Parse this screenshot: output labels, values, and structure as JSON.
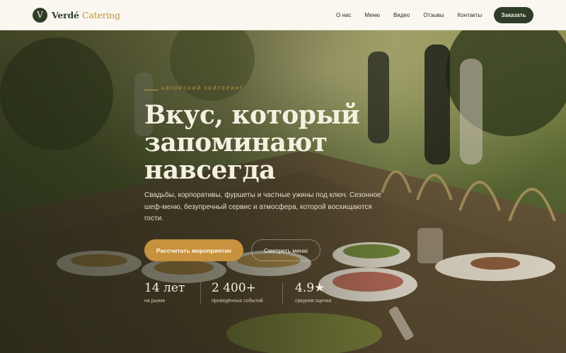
{
  "header": {
    "logo_letter": "V",
    "brand_main": "Verdé",
    "brand_accent": "Catering",
    "nav": [
      "О нас",
      "Меню",
      "Видео",
      "Отзывы",
      "Контакты"
    ],
    "order_label": "Заказать"
  },
  "hero": {
    "eyebrow": "АВТОРСКИЙ КЕЙТЕРИНГ",
    "headline_lines": [
      "Вкус, который",
      "запоминают",
      "навсегда"
    ],
    "subtitle": "Свадьбы, корпоративы, фуршеты и частные ужины под ключ. Сезонное шеф-меню, безупречный сервис и атмосфера, которой восхищаются гости.",
    "cta_primary": "Рассчитать мероприятие",
    "cta_secondary": "Смотреть меню"
  },
  "stats": [
    {
      "value": "14 лет",
      "label": "на рынке"
    },
    {
      "value": "2 400+",
      "label": "проведённых событий"
    },
    {
      "value": "4.9★",
      "label": "средняя оценка"
    }
  ],
  "colors": {
    "brand_dark": "#2e3d28",
    "accent_gold": "#c8913d",
    "header_bg": "#faf7f0"
  }
}
